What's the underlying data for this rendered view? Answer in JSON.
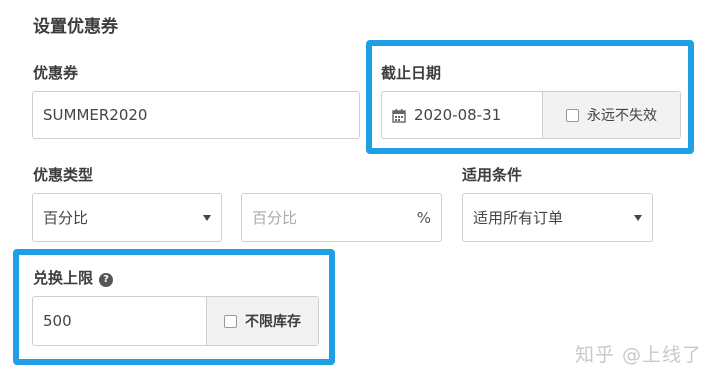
{
  "section_title": "设置优惠券",
  "coupon": {
    "label": "优惠券",
    "value": "SUMMER2020"
  },
  "expiry": {
    "label": "截止日期",
    "date_value": "2020-08-31",
    "never_expire_label": "永远不失效",
    "never_expire_checked": false
  },
  "discount_type": {
    "label": "优惠类型",
    "selected": "百分比",
    "amount_placeholder": "百分比",
    "unit": "%"
  },
  "condition": {
    "label": "适用条件",
    "selected": "适用所有订单"
  },
  "redeem_limit": {
    "label": "兑换上限",
    "help_icon": "?",
    "value": "500",
    "unlimited_label": "不限库存",
    "unlimited_checked": false
  },
  "watermark": "知乎 @上线了",
  "colors": {
    "highlight": "#1f9fe6",
    "addon_bg": "#f2f2f2",
    "border": "#cfcfcf"
  }
}
